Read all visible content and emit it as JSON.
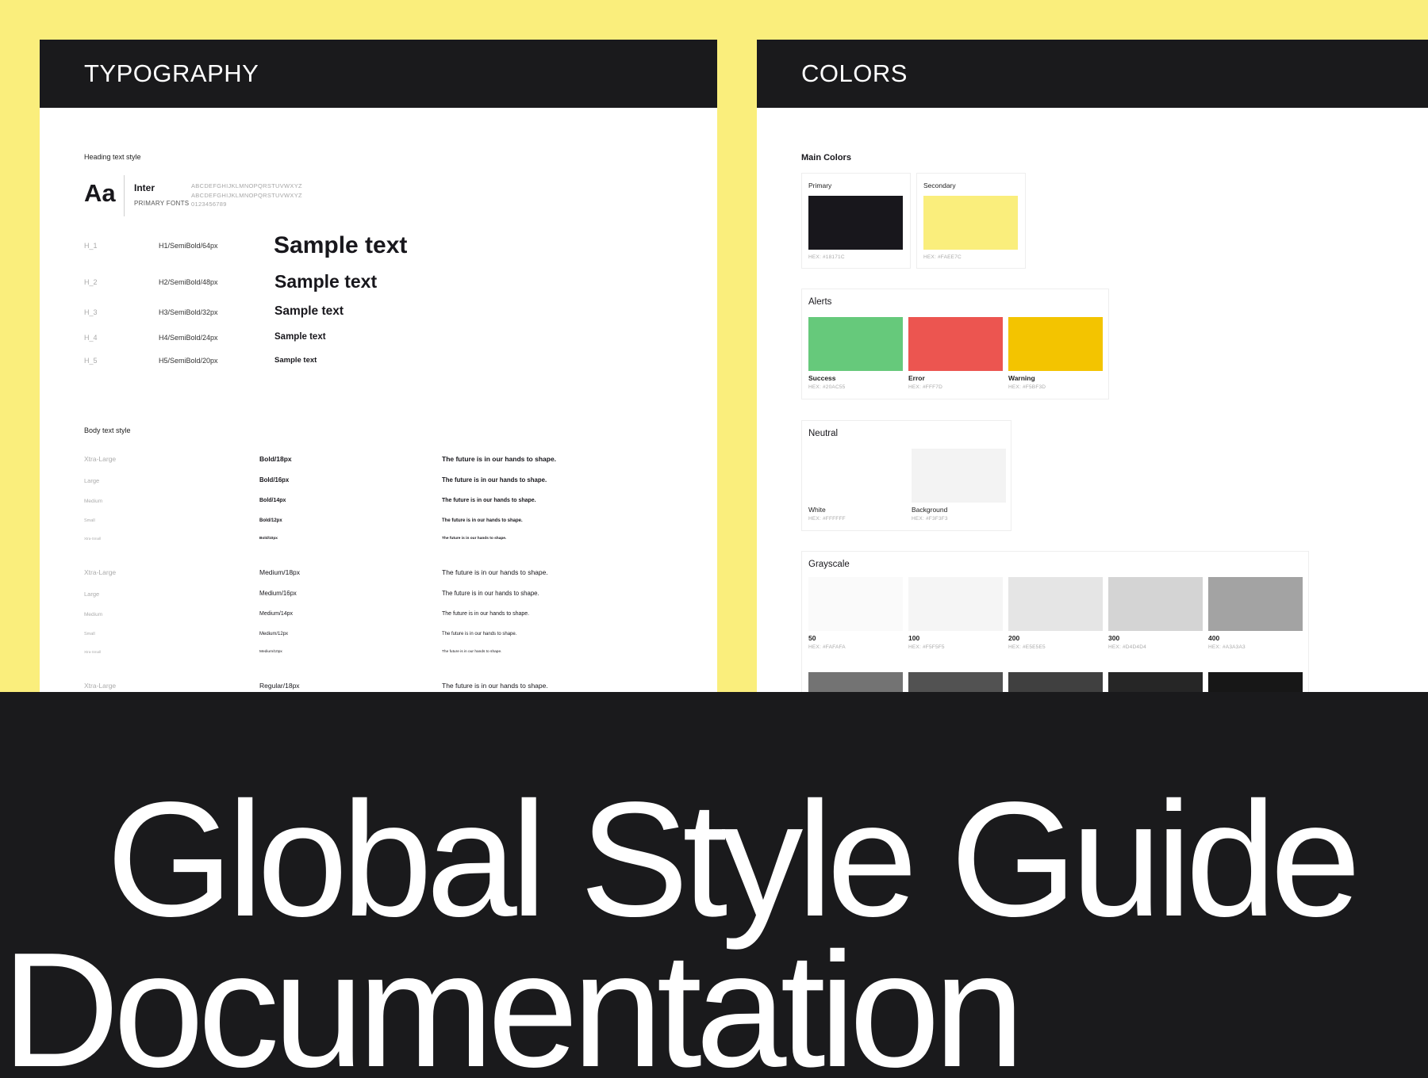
{
  "typography": {
    "title": "TYPOGRAPHY",
    "heading_section": "Heading text style",
    "font_sample": "Aa",
    "font_name": "Inter",
    "font_role": "PRIMARY FONTS",
    "glyphs": [
      "ABCDEFGHIJKLMNOPQRSTUVWXYZ",
      "ABCDEFGHIJKLMNOPQRSTUVWXYZ",
      "0123456789"
    ],
    "headings": [
      {
        "label": "H_1",
        "spec": "H1/SemiBold/64px",
        "sample": "Sample text"
      },
      {
        "label": "H_2",
        "spec": "H2/SemiBold/48px",
        "sample": "Sample text"
      },
      {
        "label": "H_3",
        "spec": "H3/SemiBold/32px",
        "sample": "Sample text"
      },
      {
        "label": "H_4",
        "spec": "H4/SemiBold/24px",
        "sample": "Sample text"
      },
      {
        "label": "H_5",
        "spec": "H5/SemiBold/20px",
        "sample": "Sample text"
      }
    ],
    "body_section": "Body text style",
    "body_rows": [
      {
        "label": "Xtra-Large",
        "spec": "Bold/18px",
        "sample": "The future is in our hands to shape."
      },
      {
        "label": "Large",
        "spec": "Bold/16px",
        "sample": "The future is in our hands to shape."
      },
      {
        "label": "Medium",
        "spec": "Bold/14px",
        "sample": "The future is in our hands to shape."
      },
      {
        "label": "Small",
        "spec": "Bold/12px",
        "sample": "The future is in our hands to shape."
      },
      {
        "label": "Xtra-Small",
        "spec": "Bold/10px",
        "sample": "The future is in our hands to shape."
      },
      {
        "label": "Xtra-Large",
        "spec": "Medium/18px",
        "sample": "The future is in our hands to shape."
      },
      {
        "label": "Large",
        "spec": "Medium/16px",
        "sample": "The future is in our hands to shape."
      },
      {
        "label": "Medium",
        "spec": "Medium/14px",
        "sample": "The future is in our hands to shape."
      },
      {
        "label": "Small",
        "spec": "Medium/12px",
        "sample": "The future is in our hands to shape."
      },
      {
        "label": "Xtra-Small",
        "spec": "Medium/10px",
        "sample": "The future is in our hands to shape."
      },
      {
        "label": "Xtra-Large",
        "spec": "Regular/18px",
        "sample": "The future is in our hands to shape."
      }
    ]
  },
  "colors": {
    "title": "COLORS",
    "main_section": "Main Colors",
    "main": [
      {
        "label": "Primary",
        "hex_text": "HEX: #18171C",
        "color": "#18171C"
      },
      {
        "label": "Secondary",
        "hex_text": "HEX: #FAEE7C",
        "color": "#FAEE7C"
      }
    ],
    "alerts_title": "Alerts",
    "alerts": [
      {
        "label": "Success",
        "hex_text": "HEX: #20AC55",
        "color": "#66C97B"
      },
      {
        "label": "Error",
        "hex_text": "HEX: #FFF7D",
        "color": "#EC5550"
      },
      {
        "label": "Warning",
        "hex_text": "HEX: #F5BF3D",
        "color": "#F3C400"
      }
    ],
    "neutral_title": "Neutral",
    "neutral": [
      {
        "label": "White",
        "hex_text": "HEX: #FFFFFF",
        "color": "#FFFFFF"
      },
      {
        "label": "Background",
        "hex_text": "HEX: #F3F3F3",
        "color": "#F3F3F3"
      }
    ],
    "grayscale_title": "Grayscale",
    "grayscale": [
      {
        "label": "50",
        "hex_text": "HEX: #FAFAFA",
        "color": "#FAFAFA"
      },
      {
        "label": "100",
        "hex_text": "HEX: #F5F5F5",
        "color": "#F5F5F5"
      },
      {
        "label": "200",
        "hex_text": "HEX: #E5E5E5",
        "color": "#E5E5E5"
      },
      {
        "label": "300",
        "hex_text": "HEX: #D4D4D4",
        "color": "#D4D4D4"
      },
      {
        "label": "400",
        "hex_text": "HEX: #A3A3A3",
        "color": "#A3A3A3"
      }
    ],
    "grayscale_row2_colors": [
      "#737373",
      "#525252",
      "#404040",
      "#262626",
      "#171717"
    ]
  },
  "banner": {
    "line1": "Global Style Guide",
    "line2": "Documentation"
  }
}
